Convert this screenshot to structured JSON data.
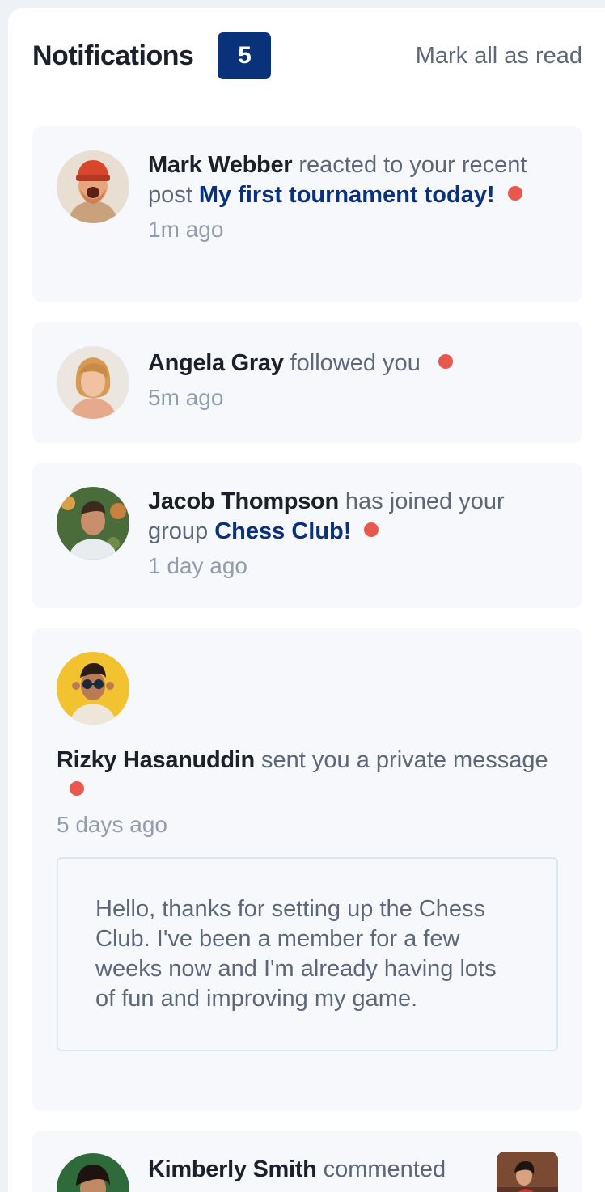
{
  "header": {
    "title": "Notifications",
    "badge_count": "5",
    "mark_all_label": "Mark all as read"
  },
  "notifications": [
    {
      "name": "Mark Webber",
      "action": " reacted to your recent post ",
      "target": "My first tournament today!",
      "time": "1m ago",
      "unread": true
    },
    {
      "name": "Angela Gray",
      "action": " followed you",
      "target": "",
      "time": "5m ago",
      "unread": true
    },
    {
      "name": "Jacob Thompson",
      "action": " has joined your group ",
      "target": "Chess Club!",
      "time": "1 day ago",
      "unread": true
    },
    {
      "name": "Rizky Hasanuddin",
      "action": " sent you a private message",
      "target": "",
      "time": "5 days ago",
      "unread": true,
      "message": "Hello, thanks for setting up the Chess Club. I've been a member for a few weeks now and I'm already having lots of fun and improving my game."
    },
    {
      "name": "Kimberly Smith",
      "action": " commented",
      "target": "",
      "time": "",
      "unread": false
    }
  ],
  "colors": {
    "accent": "#0a327b",
    "unread_dot": "#e7584f",
    "card_bg": "#f6f8fc",
    "text_dark": "#1c202b",
    "text_grey": "#5e6778"
  }
}
